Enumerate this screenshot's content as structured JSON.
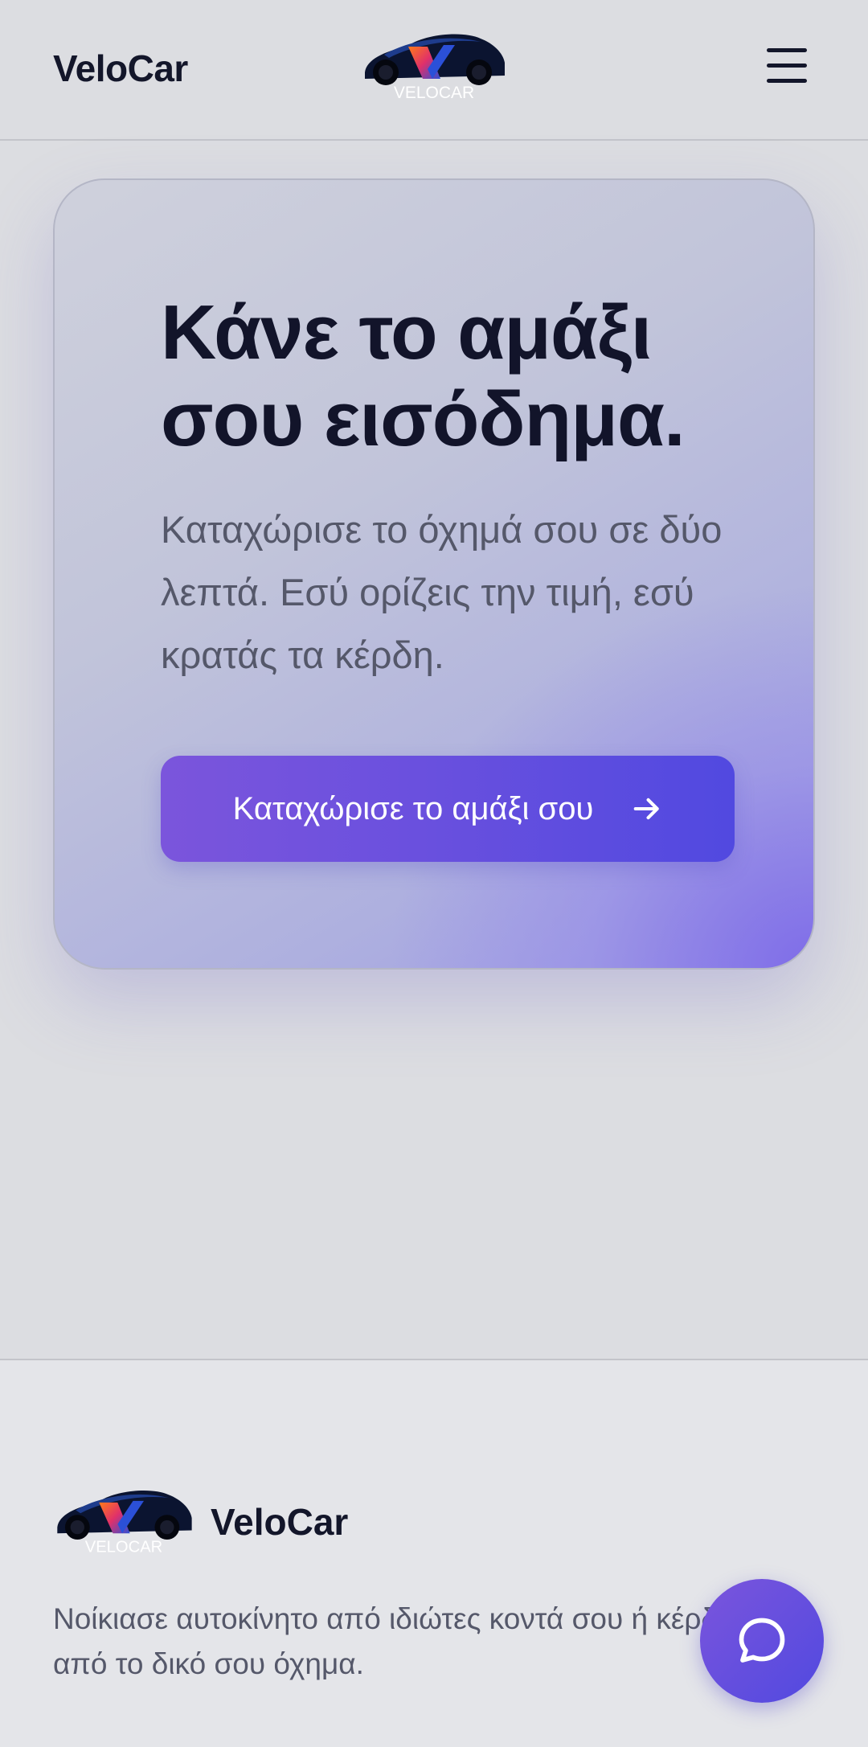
{
  "header": {
    "brand": "VeloCar",
    "logo_wordmark": "VELOCAR",
    "menu_icon": "hamburger-menu-icon"
  },
  "hero": {
    "title": "Κάνε το αμάξι σου εισόδημα.",
    "subtitle": "Καταχώρισε το όχημά σου σε δύο λεπτά. Εσύ ορίζεις την τιμή, εσύ κρατάς τα κέρδη.",
    "cta_label": "Καταχώρισε το αμάξι σου",
    "cta_icon": "arrow-right-icon"
  },
  "footer": {
    "brand": "VeloCar",
    "logo_wordmark": "VELOCAR",
    "description": "Νοίκιασε αυτοκίνητο από ιδιώτες κοντά σου ή κέρδισε από το δικό σου όχημα."
  },
  "chat": {
    "icon": "chat-bubble-icon"
  },
  "colors": {
    "accent_start": "#7b55dc",
    "accent_end": "#5149e0",
    "text_dark": "#13162a",
    "text_muted": "#55586a"
  }
}
